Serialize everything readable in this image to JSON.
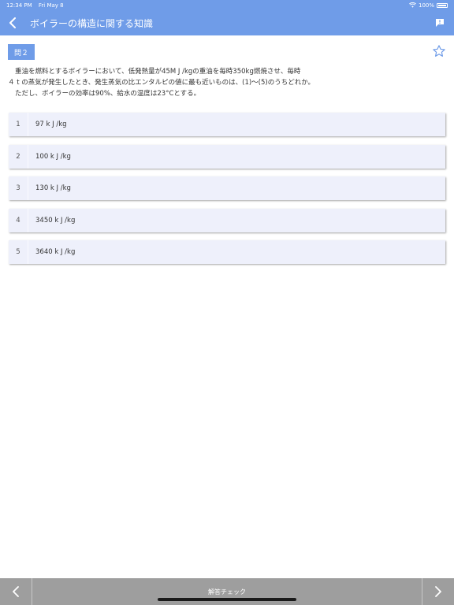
{
  "status_bar": {
    "time": "12:34 PM",
    "date": "Fri May 8",
    "battery": "100%"
  },
  "nav": {
    "title": "ボイラーの構造に関する知識"
  },
  "question": {
    "badge": "問２",
    "lines": [
      "重油を燃料とするボイラーにおいて、低発熱量が45M J /kgの重油を毎時350kg燃焼させ、毎時",
      "４ t の蒸気が発生したとき、発生蒸気の比エンタルピの値に最も近いものは、(1)〜(5)のうちどれか。",
      "ただし、ボイラーの効率は90%、給水の温度は23°Cとする。"
    ]
  },
  "choices": [
    {
      "num": "1",
      "text": "97 k J /kg"
    },
    {
      "num": "2",
      "text": "100 k J /kg"
    },
    {
      "num": "3",
      "text": "130 k J /kg"
    },
    {
      "num": "4",
      "text": "3450 k J /kg"
    },
    {
      "num": "5",
      "text": "3640 k J /kg"
    }
  ],
  "bottom": {
    "check_label": "解答チェック"
  },
  "colors": {
    "accent": "#6f9ce8",
    "choice_bg": "#eef0fb",
    "bottom_bar": "#9e9e9e"
  }
}
